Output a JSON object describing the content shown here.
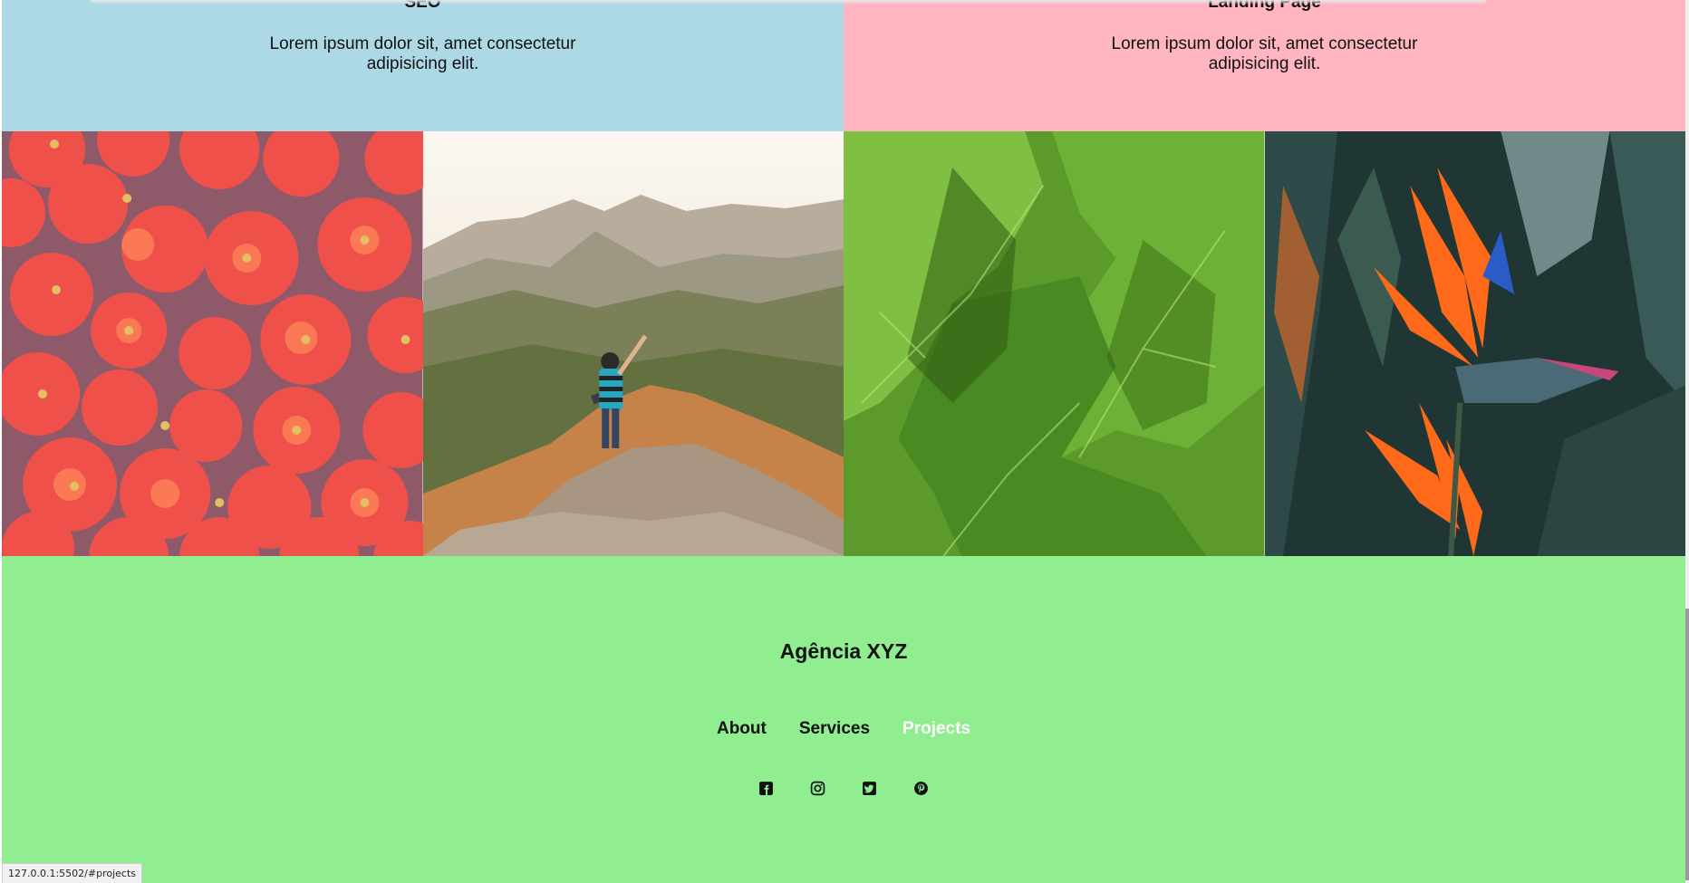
{
  "services": [
    {
      "title": "SEO",
      "description": "Lorem ipsum dolor sit, amet consectetur adipisicing elit."
    },
    {
      "title": "Landing Page",
      "description": "Lorem ipsum dolor sit, amet consectetur adipisicing elit."
    }
  ],
  "gallery": [
    {
      "subject": "tomatoes"
    },
    {
      "subject": "hiker on mountain"
    },
    {
      "subject": "green leaf"
    },
    {
      "subject": "bird of paradise flower"
    }
  ],
  "footer": {
    "brand": "Agência XYZ",
    "nav": [
      {
        "label": "About",
        "active": false
      },
      {
        "label": "Services",
        "active": false
      },
      {
        "label": "Projects",
        "active": true
      }
    ],
    "social_icons": [
      "facebook-icon",
      "instagram-icon",
      "twitter-icon",
      "pinterest-icon"
    ],
    "background_color": "#90ee90"
  },
  "colors": {
    "seo_card": "#add8e6",
    "landing_card": "#ffb6c1",
    "active_link": "#ffffff"
  },
  "status_bar": {
    "url": "127.0.0.1:5502/#projects"
  }
}
